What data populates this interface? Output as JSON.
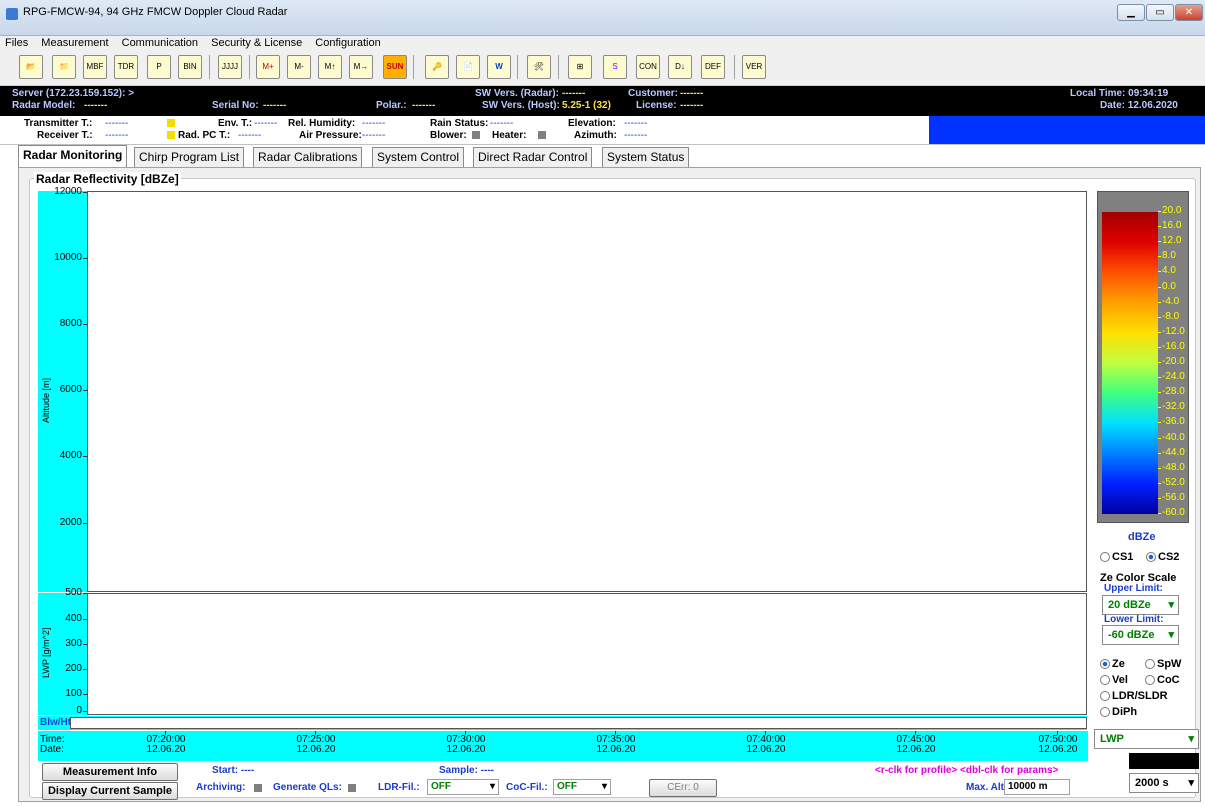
{
  "window": {
    "title": "RPG-FMCW-94, 94 GHz FMCW Doppler Cloud Radar",
    "min": "▁",
    "max": "▭",
    "close": "✕"
  },
  "menu": [
    "Files",
    "Measurement",
    "Communication",
    "Security & License",
    "Configuration"
  ],
  "toolbar": [
    "open",
    "open-data",
    "MBF",
    "TDR",
    "P",
    "BIN netCDF",
    "JJJJ",
    "M+",
    "M-",
    "M↑",
    "M→",
    "SUN",
    "key",
    "doc",
    "W",
    "tool",
    "grid",
    "S",
    "CON DEF",
    "D↓",
    "DEF",
    "VER"
  ],
  "info": {
    "server": "Server (172.23.159.152): >",
    "radar_model_label": "Radar Model:",
    "radar_model": "-------",
    "serial_label": "Serial No:",
    "serial": "-------",
    "polar_label": "Polar.:",
    "polar": "-------",
    "sw_radar_label": "SW Vers. (Radar):",
    "sw_radar": "-------",
    "sw_host_label": "SW Vers. (Host):",
    "sw_host": "5.25-1 (32)",
    "customer_label": "Customer:",
    "customer": "-------",
    "license_label": "License:",
    "license": "-------",
    "local_time": "Local Time: 09:34:19",
    "date": "Date: 12.06.2020"
  },
  "status": {
    "transmitter": "Transmitter T.:",
    "receiver": "Receiver T.:",
    "env": "Env. T.:",
    "radpc": "Rad. PC T.:",
    "humidity": "Rel. Humidity:",
    "pressure": "Air Pressure:",
    "rain": "Rain Status:",
    "blower": "Blower:",
    "heater": "Heater:",
    "elevation": "Elevation:",
    "azimuth": "Azimuth:",
    "dash": "-------"
  },
  "tabs": [
    "Radar Monitoring",
    "Chirp Program List",
    "Radar Calibrations",
    "System Control",
    "Direct Radar Control",
    "System Status"
  ],
  "group_title": "Radar Reflectivity [dBZe]",
  "plot1": {
    "ylabel": "Altitude [m]",
    "ticks": [
      "12000",
      "10000",
      "8000",
      "6000",
      "4000",
      "2000"
    ]
  },
  "plot2": {
    "ylabel": "LWP [g/m^2]",
    "ticks": [
      "500",
      "400",
      "300",
      "200",
      "100",
      "0"
    ]
  },
  "blw_label": "Blw/Ht:",
  "time_axis": {
    "left": [
      "Time:",
      "Date:"
    ],
    "labels": [
      [
        "07:20:00",
        "12.06.20"
      ],
      [
        "07:25:00",
        "12.06.20"
      ],
      [
        "07:30:00",
        "12.06.20"
      ],
      [
        "07:35:00",
        "12.06.20"
      ],
      [
        "07:40:00",
        "12.06.20"
      ],
      [
        "07:45:00",
        "12.06.20"
      ],
      [
        "07:50:00",
        "12.06.20"
      ]
    ]
  },
  "colorbar": {
    "labels": [
      "20.0",
      "16.0",
      "12.0",
      "8.0",
      "4.0",
      "0.0",
      "-4.0",
      "-8.0",
      "-12.0",
      "-16.0",
      "-20.0",
      "-24.0",
      "-28.0",
      "-32.0",
      "-36.0",
      "-40.0",
      "-44.0",
      "-48.0",
      "-52.0",
      "-56.0",
      "-60.0"
    ],
    "unit": "dBZe"
  },
  "side": {
    "cs1": "CS1",
    "cs2": "CS2",
    "scale_title": "Ze Color Scale",
    "upper_label": "Upper Limit:",
    "upper": "20 dBZe",
    "lower_label": "Lower Limit:",
    "lower": "-60 dBZe",
    "ze": "Ze",
    "spw": "SpW",
    "vel": "Vel",
    "coc": "CoC",
    "ldr": "LDR/SLDR",
    "diph": "DiPh",
    "lwp": "LWP",
    "interval": "2000 s"
  },
  "bottom": {
    "measurement_info": "Measurement Info",
    "display_current": "Display Current Sample",
    "start": "Start: ----",
    "sample": "Sample: ----",
    "archiving": "Archiving:",
    "generate_qls": "Generate QLs:",
    "ldr_fil": "LDR-Fil.:",
    "ldr_val": "OFF",
    "coc_fil": "CoC-Fil.:",
    "coc_val": "OFF",
    "cerr": "CErr: 0",
    "hint": "<r-clk for profile> <dbl-clk for params>",
    "max_alt_label": "Max. Alti:",
    "max_alt": "10000 m"
  }
}
